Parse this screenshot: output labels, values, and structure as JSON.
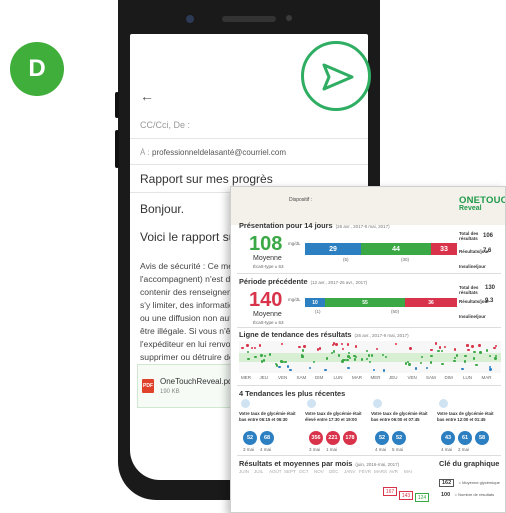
{
  "step_badge": "D",
  "email": {
    "cc_label": "CC/Cci, De :",
    "to_prefix": "À :",
    "to": "professionneldelasanté@courriel.com",
    "subject": "Rapport sur mes progrès",
    "greeting": "Bonjour.",
    "body": "Voici le rapport sur v",
    "security_lines": [
      "Avis de sécurité : Ce messa",
      "l'accompagnent) n'est dest",
      "contenir des renseignemen",
      "s'y limiter, des informations",
      "ou une diffusion non autor",
      "être illégale. Si vous n'êtes",
      "l'expéditeur en lui renvoyan",
      "supprimer ou détruire défin",
      "électroniques ou papier de"
    ],
    "attachment": {
      "name": "OneTouchReveal.pdf",
      "size": "190 KB",
      "type_label": "PDF"
    }
  },
  "report": {
    "device_label": "Dispositif :",
    "logo_top": "ONETOUCH",
    "logo_bottom": "Reveal",
    "presentation": {
      "title": "Présentation pour 14 jours",
      "date": "(26 avr., 2017-9 mai, 2017)",
      "value": "108",
      "unit": "mg/dL",
      "mean_label": "Moyenne",
      "sd_label": "Écart-type ± 63",
      "below": "29",
      "in_range": "44",
      "above": "33",
      "count_below": "(5)",
      "count_above": "(30)",
      "total_label": "Total des résultats",
      "total": "106",
      "per_day_label": "Résultats/jour",
      "per_day": "7.6",
      "insulin_label": "Insuline/jour"
    },
    "previous": {
      "title": "Période précédente",
      "date": "(12 avr., 2017-25 avr., 2017)",
      "value": "140",
      "unit": "mg/dL",
      "mean_label": "Moyenne",
      "sd_label": "Écart-type ± 63",
      "below": "10",
      "in_range": "55",
      "above": "36",
      "count_below": "(1)",
      "count_above": "(50)",
      "total_label": "Total des résultats",
      "total": "130",
      "per_day_label": "Résultats/jour",
      "per_day": "9.3",
      "insulin_label": "Insuline/jour"
    },
    "trend": {
      "title": "Ligne de tendance des résultats",
      "date": "(26 avr., 2017-9 mai, 2017)",
      "days": [
        "MER",
        "JEU",
        "VEN",
        "SAM",
        "DIM",
        "LUN",
        "MAR",
        "MER",
        "JEU",
        "VEN",
        "SAM",
        "DIM",
        "LUN",
        "MAR"
      ]
    },
    "patterns": {
      "title": "4 Tendances les plus récentes",
      "cards": [
        {
          "text1": "Votre taux de glycémie était",
          "text2": "bas entre 06:15 et 06:30",
          "v1": "52",
          "v2": "68",
          "c1": "#2c7fc1",
          "c2": "#2c7fc1",
          "d1": "3 mai",
          "d2": "4 mai"
        },
        {
          "text1": "Votre taux de glycémie était",
          "text2": "élevé entre 17:30 et 19:00",
          "v1": "356",
          "v2": "221",
          "v3": "178",
          "c1": "#d8334a",
          "c2": "#d8334a",
          "d1": "3 mai",
          "d2": "1 mai"
        },
        {
          "text1": "Votre taux de glycémie était",
          "text2": "bas entre 06:00 et 07:45",
          "v1": "52",
          "v2": "52",
          "c1": "#2c7fc1",
          "c2": "#2c7fc1",
          "d1": "4 mai",
          "d2": "5 mai"
        },
        {
          "text1": "Votre taux de glycémie était",
          "text2": "bas entre 12:00 et 01:45",
          "v1": "43",
          "v2": "61",
          "v3": "58",
          "c1": "#2c7fc1",
          "c2": "#2c7fc1",
          "d1": "4 mai",
          "d2": "2 mai"
        }
      ]
    },
    "monthly": {
      "title": "Résultats et moyennes par mois",
      "date": "(juin, 2016-mai, 2017)",
      "months": [
        "JUIN",
        "JUIL",
        "AOÛT",
        "SEPT",
        "OCT",
        "NOV",
        "DÉC",
        "JANV",
        "FÉVR",
        "MARS",
        "AVR",
        "MAI"
      ],
      "values": [
        "167",
        "143",
        "124"
      ]
    },
    "legend": {
      "title": "Clé du graphique",
      "avg_value": "162",
      "avg_label": "= Moyenne glycémique",
      "count_value": "100",
      "count_label": "= Nombre de résultats"
    }
  },
  "colors": {
    "low": "#2c7fc1",
    "in_range": "#3aa845",
    "high": "#d8334a",
    "accent": "#2fae63"
  }
}
